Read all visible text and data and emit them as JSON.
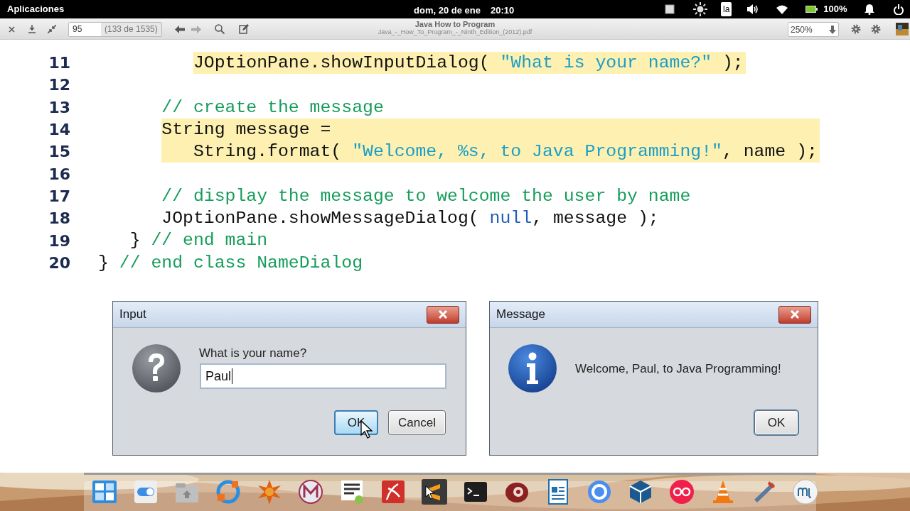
{
  "top_bar": {
    "apps_label": "Aplicaciones",
    "date": "dom, 20 de ene",
    "time": "20:10",
    "keyboard_layout": "la",
    "battery": "100%"
  },
  "toolbar": {
    "page_field": "95",
    "page_count": "(133 de 1535)",
    "title": "Java How to Program",
    "filename": "Java_-_How_To_Program_-_Ninth_Edition_(2012).pdf",
    "zoom": "250%"
  },
  "code_lines": [
    {
      "number": "11",
      "highlighted": true,
      "tokens": [
        {
          "kind": "plain",
          "text": "         JOptionPane.showInputDialog( "
        },
        {
          "kind": "string",
          "text": "\"What is your name?\""
        },
        {
          "kind": "plain",
          "text": " );"
        }
      ]
    },
    {
      "number": "12",
      "highlighted": false
    },
    {
      "number": "13",
      "highlighted": false,
      "tokens": [
        {
          "kind": "comment",
          "text": "      // create the message"
        }
      ]
    },
    {
      "number": "14",
      "highlighted": true,
      "tokens": [
        {
          "kind": "plain",
          "text": "      String message ="
        }
      ]
    },
    {
      "number": "15",
      "highlighted": true,
      "tokens": [
        {
          "kind": "plain",
          "text": "         String.format( "
        },
        {
          "kind": "string",
          "text": "\"Welcome, %s, to Java Programming!\""
        },
        {
          "kind": "plain",
          "text": ", name );"
        }
      ]
    },
    {
      "number": "16",
      "highlighted": false
    },
    {
      "number": "17",
      "highlighted": false,
      "tokens": [
        {
          "kind": "comment",
          "text": "      // display the message to welcome the user by name"
        }
      ]
    },
    {
      "number": "18",
      "highlighted": false,
      "tokens": [
        {
          "kind": "plain",
          "text": "      JOptionPane.showMessageDialog( "
        },
        {
          "kind": "keyword",
          "text": "null"
        },
        {
          "kind": "plain",
          "text": ", message );"
        }
      ]
    },
    {
      "number": "19",
      "highlighted": false,
      "tokens": [
        {
          "kind": "plain",
          "text": "   } "
        },
        {
          "kind": "comment",
          "text": "// end main"
        }
      ]
    },
    {
      "number": "20",
      "highlighted": false,
      "tokens": [
        {
          "kind": "plain",
          "text": "} "
        },
        {
          "kind": "comment",
          "text": "// end class NameDialog"
        }
      ]
    }
  ],
  "dialogs": [
    {
      "kind": "input",
      "title": "Input",
      "prompt": "What is your name?",
      "value": "Paul",
      "buttons": [
        {
          "label": "OK",
          "hovered": true
        },
        {
          "label": "Cancel",
          "hovered": false
        }
      ]
    },
    {
      "kind": "message",
      "title": "Message",
      "message": "Welcome, Paul, to Java Programming!",
      "buttons": [
        {
          "label": "OK",
          "hovered": false
        }
      ]
    }
  ]
}
